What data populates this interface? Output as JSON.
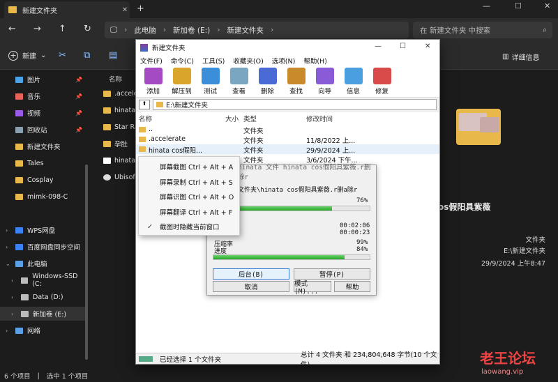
{
  "explorer": {
    "tab_title": "新建文件夹",
    "breadcrumb": [
      "此电脑",
      "新加卷 (E:)",
      "新建文件夹"
    ],
    "search_placeholder": "在 新建文件夹 中搜索",
    "new_label": "新建",
    "details_label": "详细信息",
    "sidebar": [
      {
        "label": "图片",
        "pinned": true,
        "color": "#4aa3e8"
      },
      {
        "label": "音乐",
        "pinned": true,
        "color": "#e8635a"
      },
      {
        "label": "视频",
        "pinned": true,
        "color": "#9a5ae8"
      },
      {
        "label": "回收站",
        "pinned": true,
        "color": "#8aa0b0"
      },
      {
        "label": "新建文件夹",
        "pinned": false,
        "color": "#e8b84a"
      },
      {
        "label": "Tales",
        "pinned": false,
        "color": "#e8b84a"
      },
      {
        "label": "Cosplay",
        "pinned": false,
        "color": "#e8b84a"
      },
      {
        "label": "mimk-098-C",
        "pinned": false,
        "color": "#e8b84a"
      },
      {
        "label": "WPS网盘",
        "pinned": false,
        "color": "#3b82f6"
      },
      {
        "label": "百度网盘同步空间",
        "pinned": false,
        "color": "#3b82f6"
      },
      {
        "label": "此电脑",
        "pinned": false,
        "color": "#5aa0e8"
      },
      {
        "label": "Windows-SSD (C:",
        "pinned": false,
        "color": "#bbb"
      },
      {
        "label": "Data (D:)",
        "pinned": false,
        "color": "#bbb"
      },
      {
        "label": "新加卷 (E:)",
        "pinned": false,
        "color": "#bbb"
      },
      {
        "label": "网络",
        "pinned": false,
        "color": "#5aa0e8"
      }
    ],
    "list_header": "名称",
    "files": [
      ".accele",
      "hinata",
      "Star Ra",
      "孕肚",
      "hinata",
      "Ubisof"
    ],
    "details": {
      "name": "os假阳具紫薇",
      "type": "文件夹",
      "path": "E:\\新建文件夹",
      "date": "29/9/2024 上午8:47"
    },
    "status_count": "6 个项目",
    "status_selected": "选中 1 个项目",
    "watermark_title": "老王论坛",
    "watermark_url": "laowang.vip"
  },
  "winrar": {
    "title": "新建文件夹",
    "menu": [
      "文件(F)",
      "命令(C)",
      "工具(S)",
      "收藏夹(O)",
      "选项(N)",
      "帮助(H)"
    ],
    "toolbar": [
      "添加",
      "解压到",
      "测试",
      "查看",
      "删除",
      "查找",
      "向导",
      "信息",
      "修复"
    ],
    "path": "E:\\新建文件夹",
    "columns": [
      "名称",
      "大小",
      "类型",
      "修改时间"
    ],
    "rows": [
      {
        "name": "..",
        "size": "",
        "type": "文件夹",
        "date": ""
      },
      {
        "name": ".accelerate",
        "size": "",
        "type": "文件夹",
        "date": "11/8/2022 上..."
      },
      {
        "name": "hinata cos假阳...",
        "size": "",
        "type": "文件夹",
        "date": "29/9/2024 上..."
      },
      {
        "name": "",
        "size": "",
        "type": "文件夹",
        "date": "3/6/2024 下午..."
      }
    ],
    "status_left": "已经选择 1 个文件夹",
    "status_right": "总计 4 文件夹 和 234,804,648 字节(10 个文件)"
  },
  "progress": {
    "title": "hinata 文件 hinata cos假阳具紫薇.r删除r",
    "file_line": "文件夹\\hinata cos假阳具紫薇.r删a除r",
    "file_percent": "76%",
    "file_progress": 0.76,
    "elapsed": "00:02:06",
    "remaining": "00:00:23",
    "ratio_label": "压缩率",
    "ratio_value": "99%",
    "progress_label": "进度",
    "total_percent": "84%",
    "total_progress": 0.84,
    "buttons": {
      "background": "后台(B)",
      "pause": "暂停(P)",
      "cancel": "取消",
      "mode": "模式(M)...",
      "help": "帮助"
    }
  },
  "context_menu": [
    {
      "label": "屏幕截图 Ctrl + Alt + A",
      "checked": false
    },
    {
      "label": "屏幕录制 Ctrl + Alt + S",
      "checked": false
    },
    {
      "label": "屏幕识图 Ctrl + Alt + O",
      "checked": false
    },
    {
      "label": "屏幕翻译 Ctrl + Alt + F",
      "checked": false
    },
    {
      "label": "截图时隐藏当前窗口",
      "checked": true
    }
  ]
}
